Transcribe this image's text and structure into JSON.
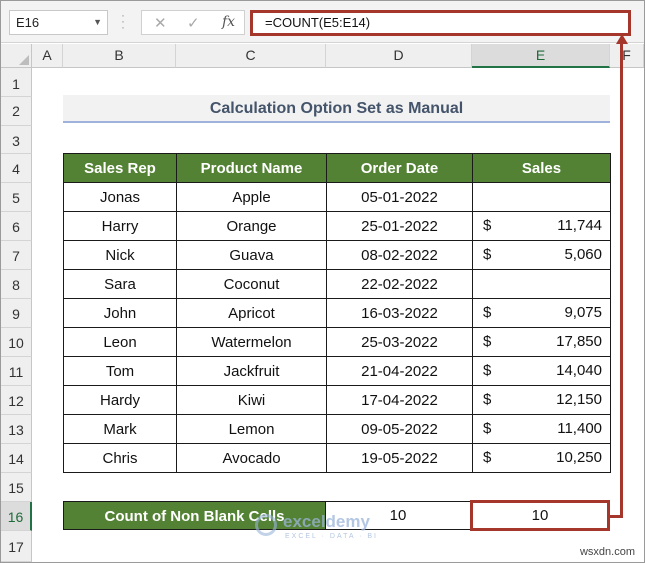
{
  "formula_bar": {
    "name_box": "E16",
    "cancel_icon": "close-icon",
    "enter_icon": "check-icon",
    "fx_label": "fx",
    "formula": "=COUNT(E5:E14)"
  },
  "columns": [
    "A",
    "B",
    "C",
    "D",
    "E",
    "F"
  ],
  "selected_column": "E",
  "rows": [
    "1",
    "2",
    "3",
    "4",
    "5",
    "6",
    "7",
    "8",
    "9",
    "10",
    "11",
    "12",
    "13",
    "14",
    "15",
    "16",
    "17"
  ],
  "selected_row": "16",
  "title": "Calculation Option Set as Manual",
  "table": {
    "headers": [
      "Sales Rep",
      "Product Name",
      "Order Date",
      "Sales"
    ],
    "rows": [
      {
        "rep": "Jonas",
        "product": "Apple",
        "date": "05-01-2022",
        "currency": "",
        "sales": ""
      },
      {
        "rep": "Harry",
        "product": "Orange",
        "date": "25-01-2022",
        "currency": "$",
        "sales": "11,744"
      },
      {
        "rep": "Nick",
        "product": "Guava",
        "date": "08-02-2022",
        "currency": "$",
        "sales": "5,060"
      },
      {
        "rep": "Sara",
        "product": "Coconut",
        "date": "22-02-2022",
        "currency": "",
        "sales": ""
      },
      {
        "rep": "John",
        "product": "Apricot",
        "date": "16-03-2022",
        "currency": "$",
        "sales": "9,075"
      },
      {
        "rep": "Leon",
        "product": "Watermelon",
        "date": "25-03-2022",
        "currency": "$",
        "sales": "17,850"
      },
      {
        "rep": "Tom",
        "product": "Jackfruit",
        "date": "21-04-2022",
        "currency": "$",
        "sales": "14,040"
      },
      {
        "rep": "Hardy",
        "product": "Kiwi",
        "date": "17-04-2022",
        "currency": "$",
        "sales": "12,150"
      },
      {
        "rep": "Mark",
        "product": "Lemon",
        "date": "09-05-2022",
        "currency": "$",
        "sales": "11,400"
      },
      {
        "rep": "Chris",
        "product": "Avocado",
        "date": "19-05-2022",
        "currency": "$",
        "sales": "10,250"
      }
    ]
  },
  "summary": {
    "label": "Count of Non Blank Cells",
    "value_d": "10",
    "value_e": "10"
  },
  "watermark": {
    "name": "exceldemy",
    "tagline": "EXCEL · DATA · BI"
  },
  "corner_mark": "wsxdn.com",
  "colors": {
    "header_green": "#548235",
    "highlight_red": "#a5362b",
    "title_text": "#44546a"
  }
}
